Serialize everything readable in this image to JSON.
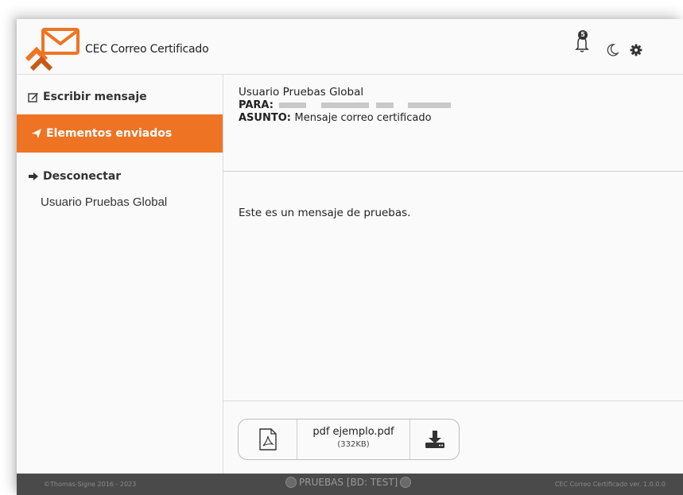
{
  "header": {
    "app_title": "CEC Correo Certificado",
    "notification_count": "5",
    "icons": [
      "bell-icon",
      "moon-icon",
      "gear-icon"
    ],
    "accent_color": "#ee7424"
  },
  "sidebar": {
    "items": [
      {
        "label": "Escribir mensaje",
        "icon": "edit-icon",
        "active": false
      },
      {
        "label": "Elementos enviados",
        "icon": "paper-plane-icon",
        "active": true
      },
      {
        "label": "Desconectar",
        "icon": "sign-out-icon",
        "active": false
      }
    ],
    "user_name": "Usuario Pruebas Global"
  },
  "message": {
    "sender": "Usuario Pruebas Global",
    "to_label": "PARA:",
    "subject_label": "ASUNTO:",
    "subject": "Mensaje correo certificado",
    "body": "Este es un mensaje de pruebas.",
    "attachment": {
      "file_name": "pdf ejemplo.pdf",
      "file_size": "(332KB)",
      "icon": "pdf-file-icon",
      "download_icon": "download-icon"
    }
  },
  "footer": {
    "copyright": "©Thomas-Signe 2016 - 2023",
    "environment": "PRUEBAS [BD: TEST]",
    "version": "CEC Correo Certificado ver. 1.0.0.0"
  }
}
